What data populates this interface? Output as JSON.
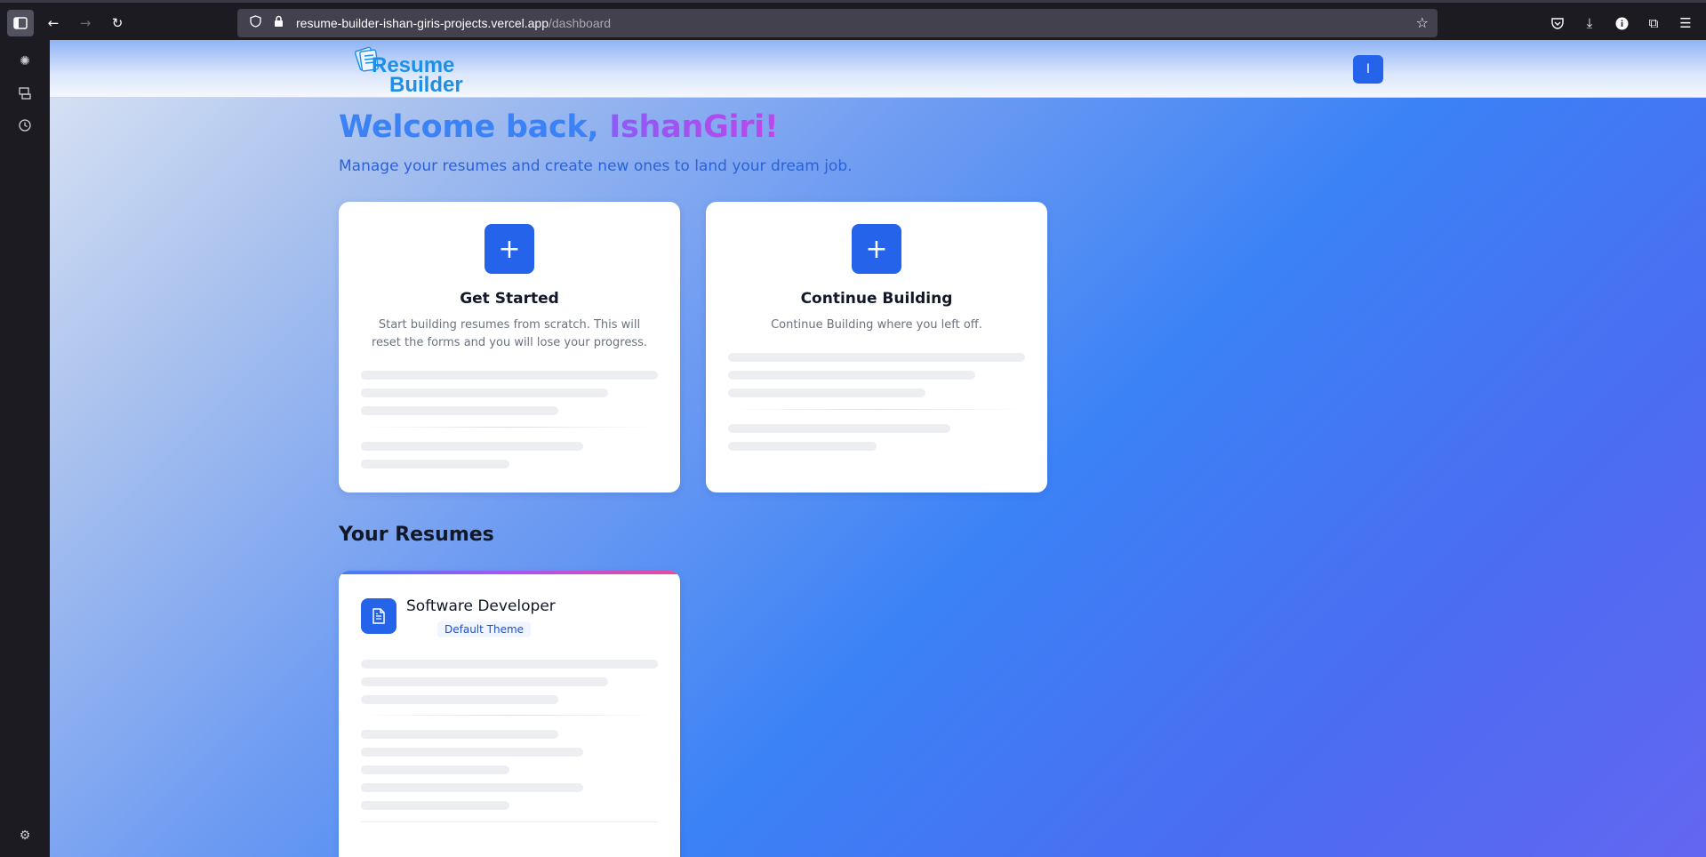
{
  "browser": {
    "url_host": "resume-builder-ishan-giris-projects.vercel.app",
    "url_path": "/dashboard"
  },
  "site": {
    "logo_line1": "Resume",
    "logo_line2": "Builder",
    "avatar_initial": "I"
  },
  "welcome": {
    "prefix": "Welcome back, ",
    "name": "IshanGiri!",
    "subtitle": "Manage your resumes and create new ones to land your dream job."
  },
  "cards": [
    {
      "icon": "plus-icon",
      "title": "Get Started",
      "description": "Start building resumes from scratch. This will reset the forms and you will lose your progress."
    },
    {
      "icon": "plus-icon",
      "title": "Continue Building",
      "description": "Continue Building where you left off."
    }
  ],
  "resumes": {
    "section_title": "Your Resumes",
    "items": [
      {
        "title": "Software Developer",
        "theme": "Default Theme",
        "icon": "document-icon"
      }
    ]
  },
  "colors": {
    "accent": "#2563eb",
    "heading_blue": "#3b82f6",
    "name_gradient_start": "#8b5cf6",
    "name_gradient_end": "#c045ea"
  }
}
